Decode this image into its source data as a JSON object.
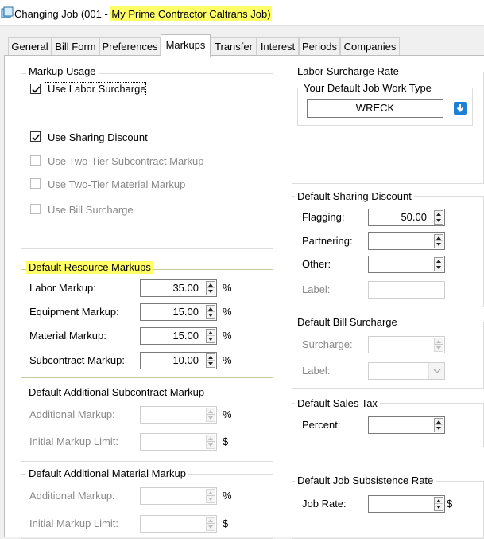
{
  "window": {
    "title_prefix": "Changing Job  (001 - ",
    "title_highlight": "My Prime Contractor Caltrans Job)"
  },
  "colors": {
    "highlight": "#ffff66",
    "selection_blue": "#1e7fd8"
  },
  "tabs": [
    {
      "label": "General"
    },
    {
      "label": "Bill Form"
    },
    {
      "label": "Preferences"
    },
    {
      "label": "Markups",
      "active": true
    },
    {
      "label": "Transfer"
    },
    {
      "label": "Interest"
    },
    {
      "label": "Periods"
    },
    {
      "label": "Companies"
    }
  ],
  "markup_usage": {
    "title": "Markup Usage",
    "labor_surcharge": {
      "label": "Use Labor Surcharge",
      "checked": true
    },
    "sharing_discount": {
      "label": "Use Sharing Discount",
      "checked": true
    },
    "two_tier_subcontract": {
      "label": "Use Two-Tier Subcontract Markup",
      "checked": false
    },
    "two_tier_material": {
      "label": "Use Two-Tier Material Markup",
      "checked": false
    },
    "bill_surcharge": {
      "label": "Use Bill Surcharge",
      "checked": false
    }
  },
  "resource_markups": {
    "title": "Default Resource Markups",
    "labor": {
      "label": "Labor Markup:",
      "value": "35.00",
      "unit": "%"
    },
    "equipment": {
      "label": "Equipment Markup:",
      "value": "15.00",
      "unit": "%"
    },
    "material": {
      "label": "Material Markup:",
      "value": "15.00",
      "unit": "%"
    },
    "subcontract": {
      "label": "Subcontract Markup:",
      "value": "10.00",
      "unit": "%"
    }
  },
  "additional_subcontract": {
    "title": "Default Additional Subcontract Markup",
    "additional": {
      "label": "Additional Markup:",
      "value": "",
      "unit": "%"
    },
    "limit": {
      "label": "Initial Markup Limit:",
      "value": "",
      "unit": "$"
    }
  },
  "additional_material": {
    "title": "Default Additional Material Markup",
    "additional": {
      "label": "Additional Markup:",
      "value": "",
      "unit": "%"
    },
    "limit": {
      "label": "Initial Markup Limit:",
      "value": "",
      "unit": "$"
    }
  },
  "labor_surcharge_rate": {
    "title": "Labor Surcharge Rate",
    "work_type_title": "Your Default Job Work Type",
    "work_type_value": "WRECK"
  },
  "sharing_discount": {
    "title": "Default Sharing Discount",
    "flagging": {
      "label": "Flagging:",
      "value": "50.00"
    },
    "partnering": {
      "label": "Partnering:",
      "value": ""
    },
    "other": {
      "label": "Other:",
      "value": ""
    },
    "label": {
      "label": "Label:",
      "value": ""
    }
  },
  "bill_surcharge": {
    "title": "Default Bill Surcharge",
    "surcharge": {
      "label": "Surcharge:",
      "value": ""
    },
    "label": {
      "label": "Label:",
      "value": ""
    }
  },
  "sales_tax": {
    "title": "Default Sales Tax",
    "percent": {
      "label": "Percent:",
      "value": ""
    }
  },
  "subsistence": {
    "title": "Default Job Subsistence Rate",
    "job_rate": {
      "label": "Job Rate:",
      "value": "",
      "unit": "$"
    }
  }
}
